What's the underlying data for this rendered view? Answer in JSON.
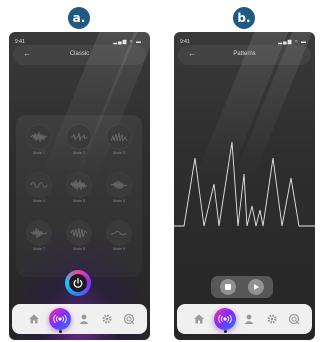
{
  "labels": {
    "a": "a.",
    "b": "b."
  },
  "phone_a": {
    "status": {
      "time": "9:41",
      "icons": "▂▄▆ ≈ ▬"
    },
    "header": {
      "back": "←",
      "title": "Classic"
    },
    "modes": [
      {
        "name": "Mode 1",
        "icon": "waveform-icon"
      },
      {
        "name": "Mode 2",
        "icon": "waveform-icon"
      },
      {
        "name": "Mode 3",
        "icon": "waveform-icon"
      },
      {
        "name": "Mode 4",
        "icon": "waveform-icon"
      },
      {
        "name": "Mode 5",
        "icon": "waveform-icon"
      },
      {
        "name": "Mode 6",
        "icon": "waveform-icon"
      },
      {
        "name": "Mode 7",
        "icon": "waveform-icon"
      },
      {
        "name": "Mode 8",
        "icon": "waveform-icon"
      },
      {
        "name": "Mode 9",
        "icon": "waveform-icon"
      }
    ],
    "power_icon": "power-icon",
    "nav": [
      "home-icon",
      "vibration-icon",
      "user-icon",
      "settings-icon",
      "support-icon"
    ],
    "active_nav": 1
  },
  "phone_b": {
    "status": {
      "time": "9:41",
      "icons": "▂▄▆ ≈ ▬"
    },
    "header": {
      "back": "←",
      "title": "Patterns"
    },
    "controls": [
      "stop-icon",
      "play-icon"
    ],
    "nav": [
      "home-icon",
      "vibration-icon",
      "user-icon",
      "settings-icon",
      "support-icon"
    ],
    "active_nav": 1
  },
  "colors": {
    "badge": "#1e5a84",
    "accent_pink": "#ff2fa0",
    "accent_purple": "#7a2cff",
    "accent_blue": "#2a78ff"
  }
}
